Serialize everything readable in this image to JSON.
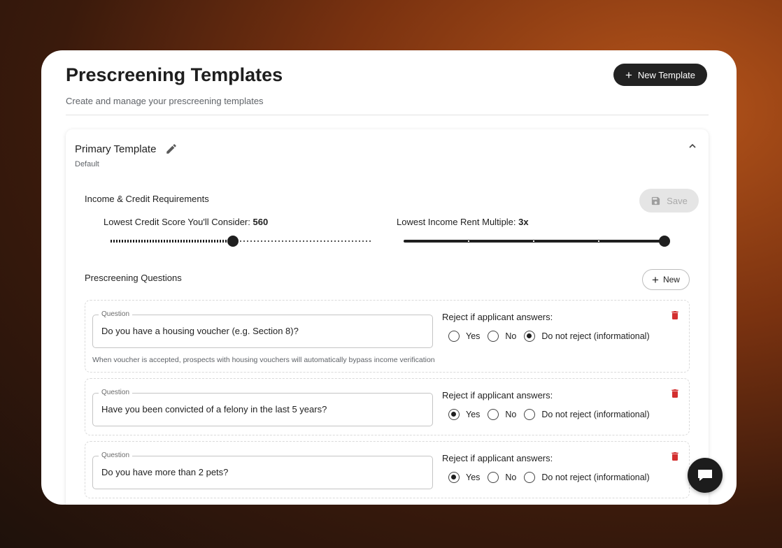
{
  "header": {
    "title": "Prescreening Templates",
    "subtitle": "Create and manage your prescreening templates",
    "new_template_label": "New Template"
  },
  "template": {
    "name": "Primary Template",
    "status": "Default",
    "income_section_title": "Income & Credit Requirements",
    "save_label": "Save",
    "credit_label": "Lowest Credit Score You'll Consider:",
    "credit_value": "560",
    "credit_fraction": 0.47,
    "income_label": "Lowest Income Rent Multiple:",
    "income_value": "3x",
    "income_fraction": 1.0
  },
  "questions_section": {
    "title": "Prescreening Questions",
    "new_label": "New",
    "question_legend": "Question",
    "reject_label": "Reject if applicant answers:",
    "options": [
      "Yes",
      "No",
      "Do not reject (informational)"
    ],
    "items": [
      {
        "text": "Do you have a housing voucher (e.g. Section 8)?",
        "selected": "Do not reject (informational)",
        "helper": "When voucher is accepted, prospects with housing vouchers will automatically bypass income verification"
      },
      {
        "text": "Have you been convicted of a felony in the last 5 years?",
        "selected": "Yes",
        "helper": ""
      },
      {
        "text": "Do you have more than 2 pets?",
        "selected": "Yes",
        "helper": ""
      }
    ]
  },
  "colors": {
    "primary_dark": "#222222",
    "danger": "#d32f2f",
    "disabled": "#e5e5e5"
  }
}
